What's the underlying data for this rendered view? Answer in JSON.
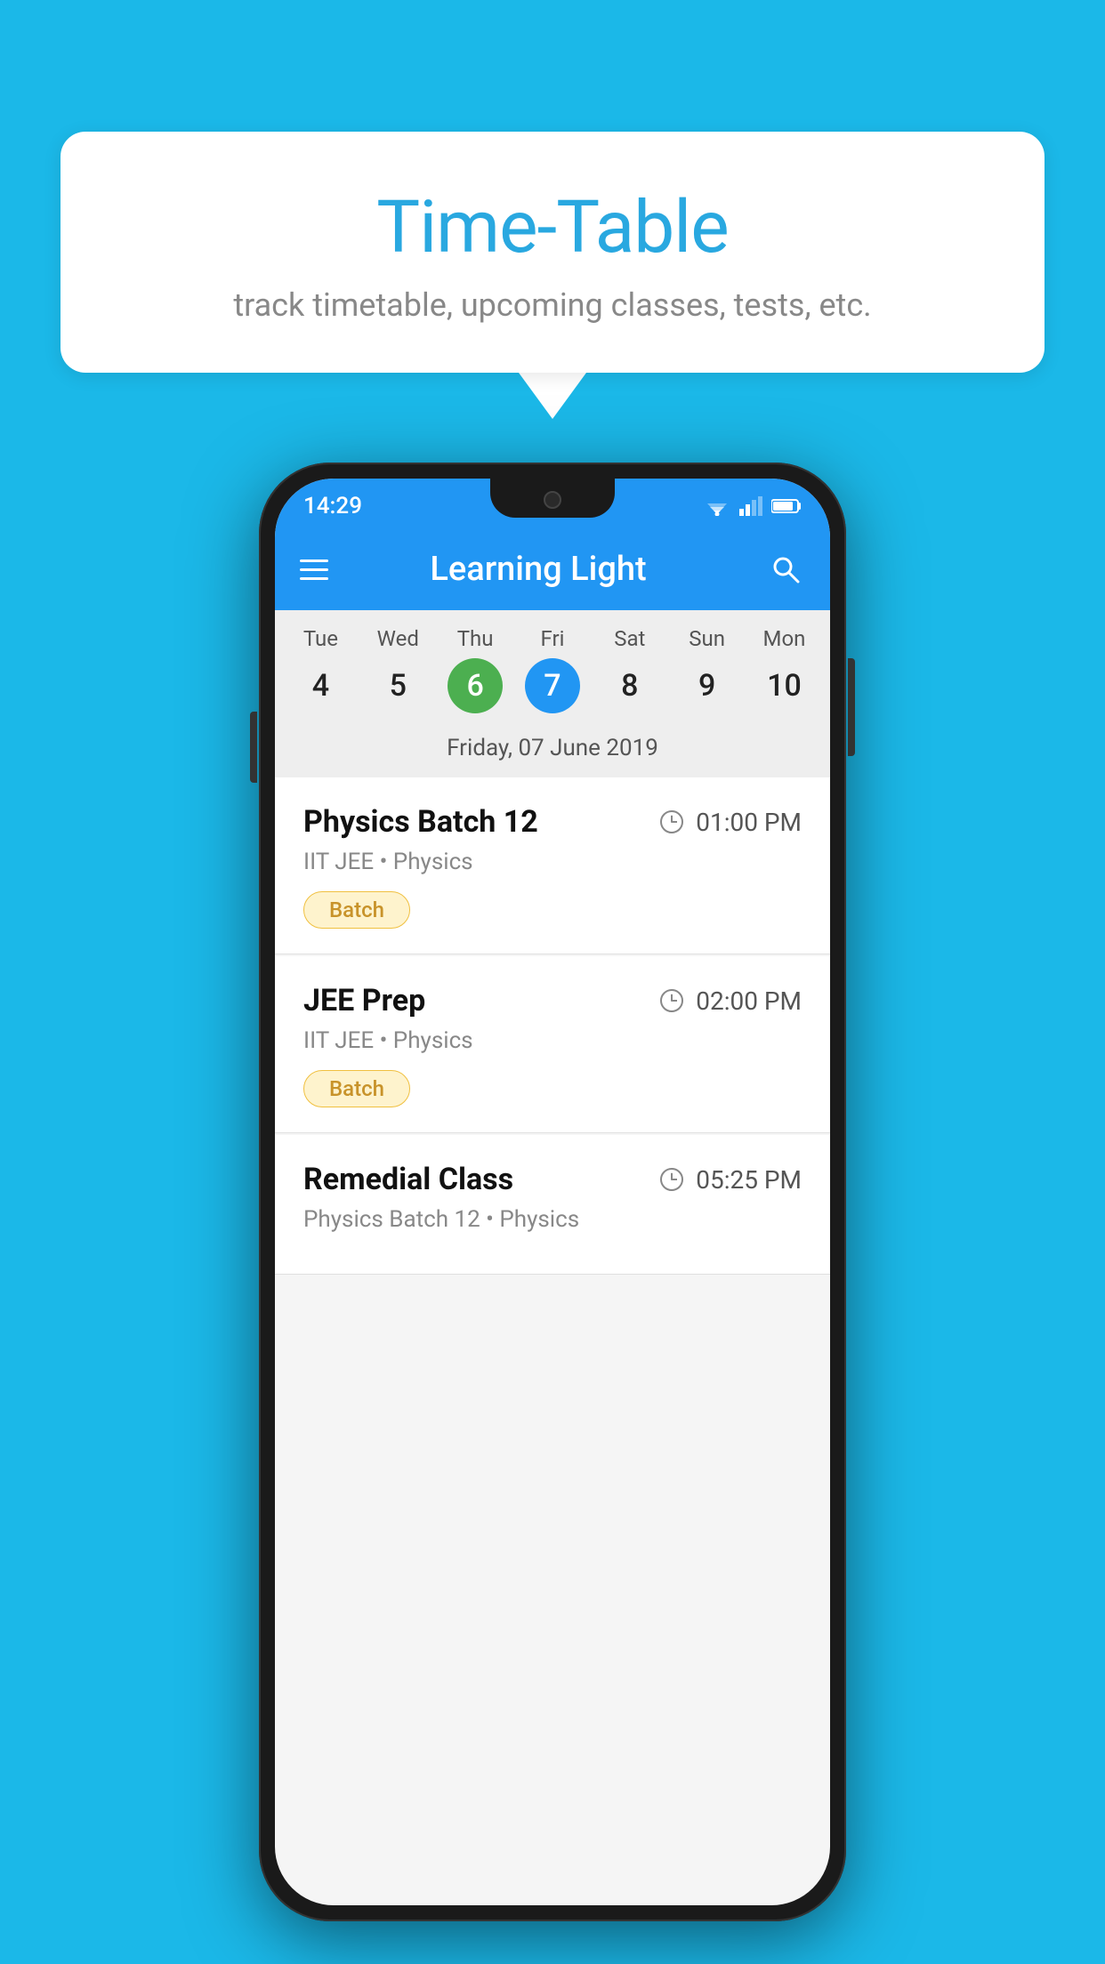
{
  "background_color": "#1bb8e8",
  "speech_bubble": {
    "title": "Time-Table",
    "subtitle": "track timetable, upcoming classes, tests, etc."
  },
  "status_bar": {
    "time": "14:29"
  },
  "app_bar": {
    "title": "Learning Light",
    "menu_icon_label": "menu",
    "search_icon_label": "search"
  },
  "calendar": {
    "selected_date_label": "Friday, 07 June 2019",
    "days": [
      {
        "label": "Tue",
        "number": "4",
        "state": "normal"
      },
      {
        "label": "Wed",
        "number": "5",
        "state": "normal"
      },
      {
        "label": "Thu",
        "number": "6",
        "state": "today"
      },
      {
        "label": "Fri",
        "number": "7",
        "state": "selected"
      },
      {
        "label": "Sat",
        "number": "8",
        "state": "normal"
      },
      {
        "label": "Sun",
        "number": "9",
        "state": "normal"
      },
      {
        "label": "Mon",
        "number": "10",
        "state": "normal"
      }
    ]
  },
  "schedule": {
    "items": [
      {
        "title": "Physics Batch 12",
        "time": "01:00 PM",
        "subtitle": "IIT JEE • Physics",
        "tag": "Batch"
      },
      {
        "title": "JEE Prep",
        "time": "02:00 PM",
        "subtitle": "IIT JEE • Physics",
        "tag": "Batch"
      },
      {
        "title": "Remedial Class",
        "time": "05:25 PM",
        "subtitle": "Physics Batch 12 • Physics",
        "tag": null
      }
    ]
  }
}
